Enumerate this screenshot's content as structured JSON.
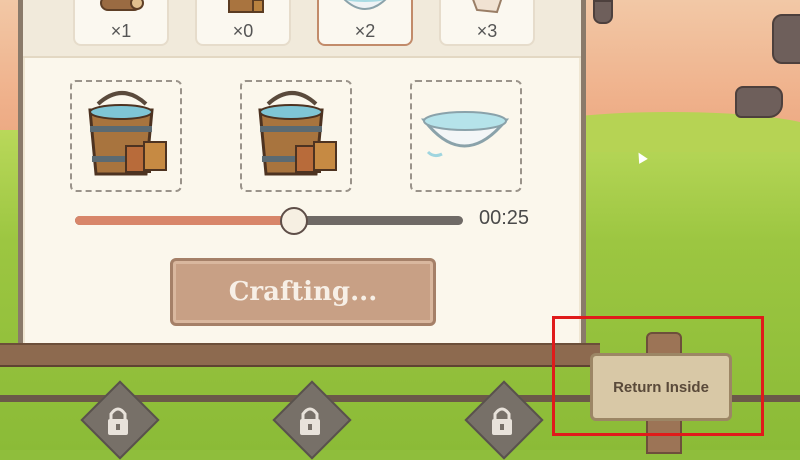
{
  "ingredients": [
    {
      "count": "×1",
      "icon": "logs-icon"
    },
    {
      "count": "×0",
      "icon": "water-bucket-icon"
    },
    {
      "count": "×2",
      "icon": "water-bowl-icon"
    },
    {
      "count": "×3",
      "icon": "cloth-icon"
    }
  ],
  "outputs": [
    "water-bucket-icon",
    "water-bucket-icon",
    "water-bowl-icon"
  ],
  "progress": {
    "fraction": 0.56,
    "timer": "00:25"
  },
  "craft_button": {
    "label": "Crafting..."
  },
  "sign": {
    "label": "Return Inside"
  },
  "colors": {
    "accent_fill": "#d8866a",
    "highlight": "#e01b1b"
  }
}
